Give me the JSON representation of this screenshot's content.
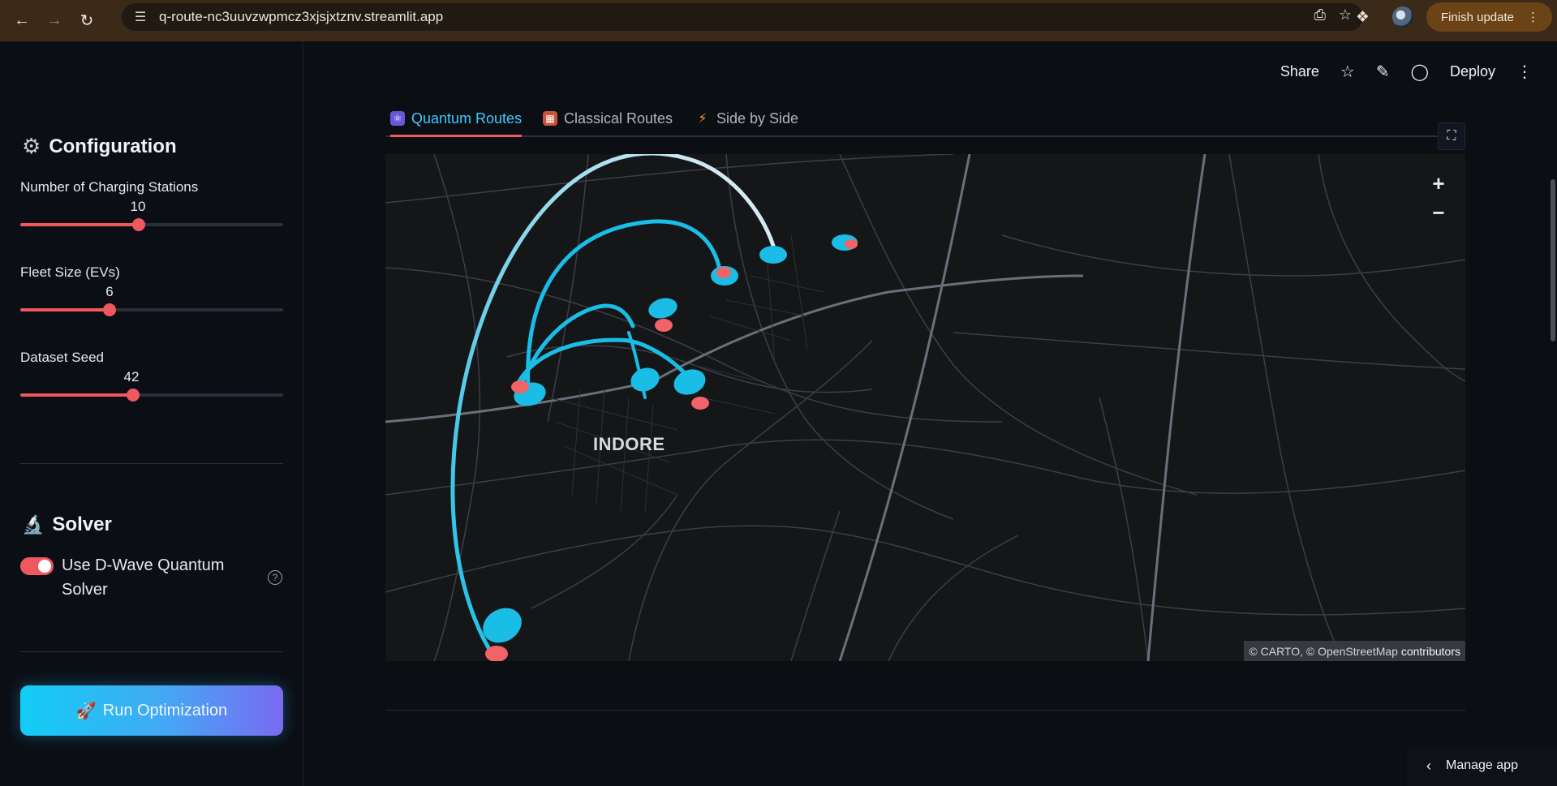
{
  "browser": {
    "url": "q-route-nc3uuvzwpmcz3xjsjxtznv.streamlit.app",
    "finish_update": "Finish update"
  },
  "sidebar": {
    "configuration": {
      "title": "Configuration",
      "icon": "gear-icon",
      "sliders": [
        {
          "label": "Number of Charging Stations",
          "value": "10",
          "fraction": 0.45
        },
        {
          "label": "Fleet Size (EVs)",
          "value": "6",
          "fraction": 0.34
        },
        {
          "label": "Dataset Seed",
          "value": "42",
          "fraction": 0.43
        }
      ]
    },
    "solver": {
      "title": "Solver",
      "icon": "microscope-icon",
      "toggle_label": "Use D-Wave Quantum Solver",
      "toggle_on": true
    },
    "run_button": "Run Optimization"
  },
  "toolbar": {
    "share": "Share",
    "deploy": "Deploy"
  },
  "tabs": [
    {
      "label": "Quantum Routes",
      "icon": "atom-icon",
      "active": true
    },
    {
      "label": "Classical Routes",
      "icon": "abacus-icon",
      "active": false
    },
    {
      "label": "Side by Side",
      "icon": "lightning-icon",
      "active": false
    }
  ],
  "map": {
    "city_label": "INDORE",
    "attribution_carto": "© CARTO",
    "attribution_osm": "© OpenStreetMap",
    "attribution_suffix": "contributors",
    "colors": {
      "station": "#19bde6",
      "vehicle": "#f06468",
      "arc_start": "#19bde6",
      "arc_end": "#e8eef2"
    }
  },
  "manage_app": "Manage app"
}
